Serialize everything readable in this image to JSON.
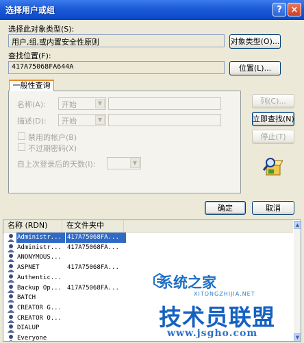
{
  "window": {
    "title": "选择用户或组",
    "help_label": "?",
    "close_label": "×"
  },
  "object_type": {
    "label": "选择此对象类型(S):",
    "value": "用户,组,或内置安全性原则",
    "button": "对象类型(O)..."
  },
  "location": {
    "label": "查找位置(F):",
    "value": "417A75068FA644A",
    "button": "位置(L)..."
  },
  "tab": {
    "label": "一般性查询",
    "name_label": "名称(A):",
    "name_combo": "开始",
    "desc_label": "描述(D):",
    "desc_combo": "开始",
    "disabled_accounts": "禁用的帐户(B)",
    "no_expire_password": "不过期密码(X)",
    "days_since_logon": "自上次登录后的天数(I):"
  },
  "side_buttons": {
    "columns": "列(C)...",
    "find_now": "立即查找(N)",
    "stop": "停止(T)"
  },
  "dialog_buttons": {
    "ok": "确定",
    "cancel": "取消"
  },
  "results": {
    "columns": [
      "名称 (RDN)",
      "在文件夹中"
    ],
    "rows": [
      {
        "name": "Administr...",
        "folder": "417A75068FA...",
        "selected": true
      },
      {
        "name": "Administr...",
        "folder": "417A75068FA...",
        "selected": false
      },
      {
        "name": "ANONYMOUS...",
        "folder": "",
        "selected": false
      },
      {
        "name": "ASPNET",
        "folder": "417A75068FA...",
        "selected": false
      },
      {
        "name": "Authentic...",
        "folder": "",
        "selected": false
      },
      {
        "name": "Backup Op...",
        "folder": "417A75068FA...",
        "selected": false
      },
      {
        "name": "BATCH",
        "folder": "",
        "selected": false
      },
      {
        "name": "CREATOR G...",
        "folder": "",
        "selected": false
      },
      {
        "name": "CREATOR O...",
        "folder": "",
        "selected": false
      },
      {
        "name": "DIALUP",
        "folder": "",
        "selected": false
      },
      {
        "name": "Everyone",
        "folder": "",
        "selected": false
      }
    ]
  },
  "watermark": {
    "line1": "系统之家",
    "line2": "XITONGZHIJIA.NET",
    "line3": "技术员联盟",
    "line4": "www.jsgho.com"
  },
  "colors": {
    "titlebar": "#0a48c9",
    "selection": "#316ac5",
    "dialog_bg": "#ece9d8"
  }
}
